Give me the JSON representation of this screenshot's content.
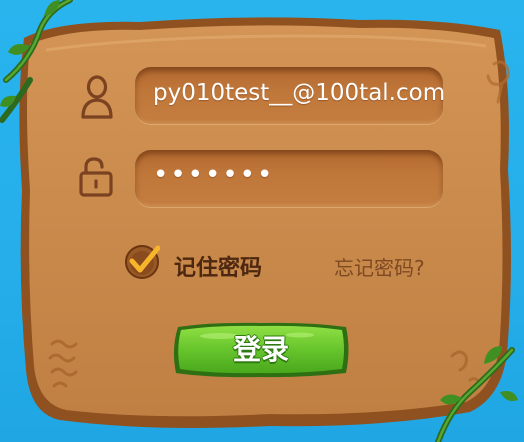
{
  "login": {
    "username_value": "py010test__@100tal.com",
    "password_value": "•••••••",
    "remember_label": "记住密码",
    "remember_checked": true,
    "forgot_label": "忘记密码?",
    "submit_label": "登录"
  },
  "icons": {
    "user": "user-icon",
    "lock": "unlock-icon",
    "check": "check-icon"
  },
  "colors": {
    "sky": "#29b4ee",
    "board": "#c98a4c",
    "board_edge": "#8a4a1c",
    "button_green": "#6cc82c",
    "label_dark": "#4d2710",
    "label_muted": "#7e4a22"
  }
}
